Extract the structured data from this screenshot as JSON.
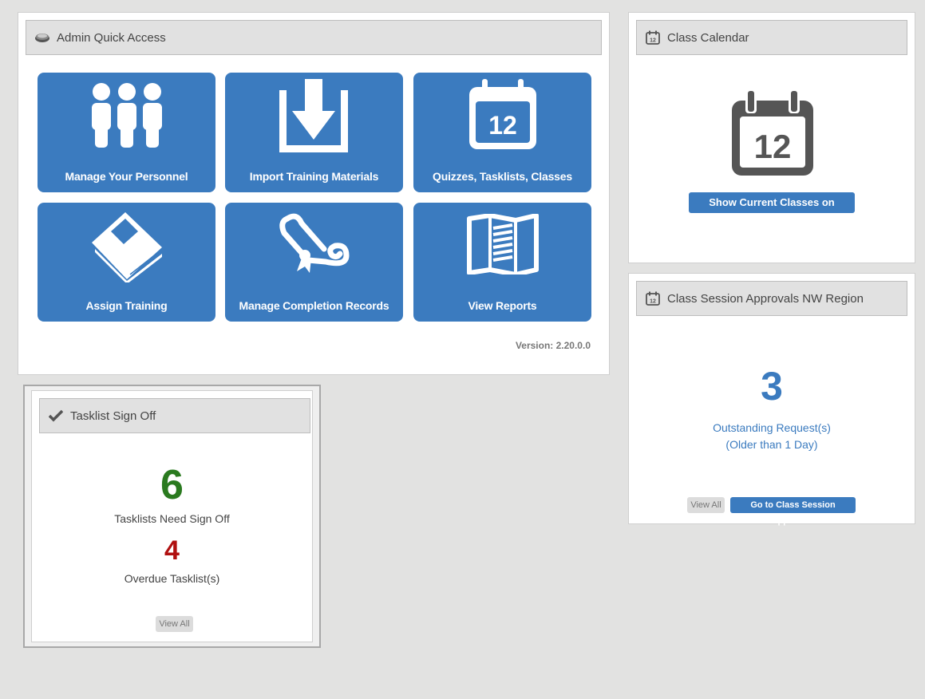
{
  "admin": {
    "title": "Admin Quick Access",
    "tiles": [
      {
        "label": "Manage Your Personnel",
        "icon": "people-icon"
      },
      {
        "label": "Import Training Materials",
        "icon": "import-icon"
      },
      {
        "label": "Quizzes, Tasklists, Classes",
        "icon": "calendar-icon"
      },
      {
        "label": "Assign Training",
        "icon": "book-icon"
      },
      {
        "label": "Manage Completion Records",
        "icon": "diploma-icon"
      },
      {
        "label": "View Reports",
        "icon": "report-icon"
      }
    ],
    "calendar_day": "12",
    "version": "Version: 2.20.0.0"
  },
  "calendar": {
    "title": "Class Calendar",
    "day": "12",
    "button": "Show Current Classes on Calendar"
  },
  "approvals": {
    "title": "Class Session Approvals NW Region",
    "count": "3",
    "line1": "Outstanding Request(s)",
    "line2": "(Older than 1 Day)",
    "view_all": "View All",
    "go_button": "Go to Class Session Approvals",
    "day": "12"
  },
  "tasklist": {
    "title": "Tasklist Sign Off",
    "need_count": "6",
    "need_label": "Tasklists Need Sign Off",
    "overdue_count": "4",
    "overdue_label": "Overdue Tasklist(s)",
    "view_all": "View All"
  },
  "colors": {
    "accent": "#3b7bbf",
    "green": "#2a7a1f",
    "red": "#b01010",
    "background": "#e2e2e1"
  }
}
